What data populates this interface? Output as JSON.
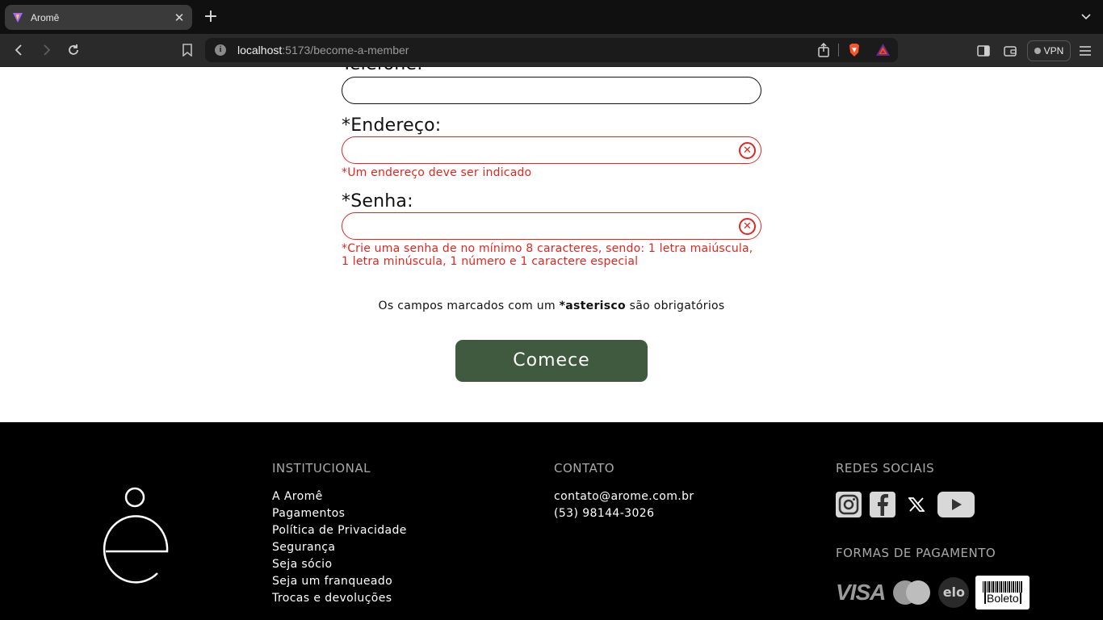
{
  "browser": {
    "tab_title": "Aromê",
    "url_host": "localhost",
    "url_path": ":5173/become-a-member",
    "vpn_label": "VPN"
  },
  "form": {
    "phone_label": "Telefone:",
    "address_label": "*Endereço:",
    "address_error": "*Um endereço deve ser indicado",
    "password_label": "*Senha:",
    "password_error": "*Crie uma senha de no mínimo 8 caracteres, sendo: 1 letra maiúscula, 1 letra minúscula, 1 número e 1 caractere especial",
    "notice_before": "Os campos marcados com um ",
    "notice_bold": "*asterisco",
    "notice_after": " são obrigatórios",
    "submit_label": "Comece",
    "error_color": "#e3261f",
    "button_color": "#3f5a3f"
  },
  "footer": {
    "institutional_heading": "INSTITUCIONAL",
    "institutional_links": [
      "A Aromê",
      "Pagamentos",
      "Política de Privacidade",
      "Segurança",
      "Seja sócio",
      "Seja um franqueado",
      "Trocas e devoluções"
    ],
    "contact_heading": "CONTATO",
    "contact_email": "contato@arome.com.br",
    "contact_phone": "(53) 98144-3026",
    "social_heading": "REDES SOCIAIS",
    "social_icons": [
      "instagram-icon",
      "facebook-icon",
      "x-icon",
      "youtube-icon"
    ],
    "payment_heading": "FORMAS DE PAGAMENTO",
    "payment_visa": "VISA",
    "payment_elo": "elo",
    "payment_boleto": "Boleto"
  }
}
